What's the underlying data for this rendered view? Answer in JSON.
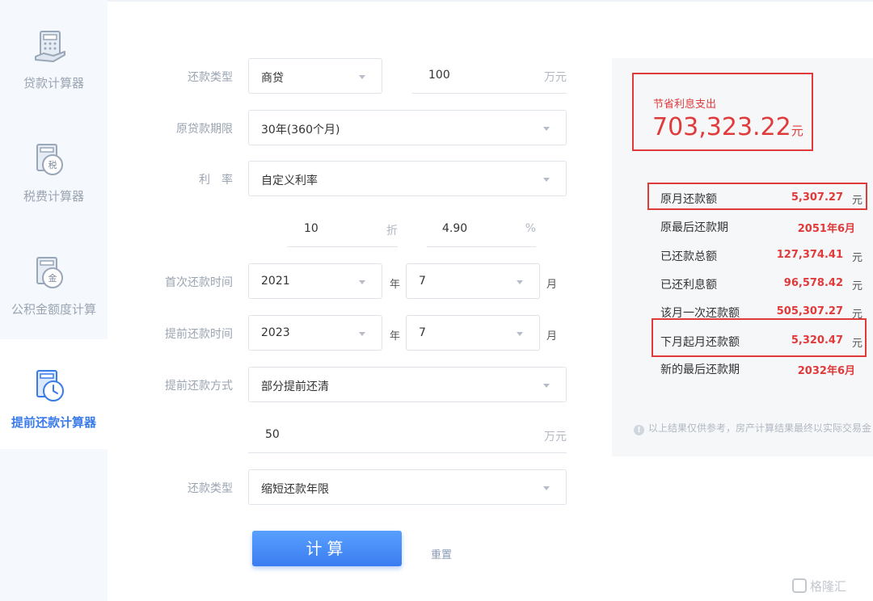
{
  "sidebar": {
    "items": [
      {
        "label": "贷款计算器",
        "icon": "loan-calculator-icon"
      },
      {
        "label": "税费计算器",
        "icon": "tax-calculator-icon"
      },
      {
        "label": "公积金额度计算",
        "icon": "fund-calculator-icon"
      },
      {
        "label": "提前还款计算器",
        "icon": "prepayment-calculator-icon",
        "active": true
      }
    ],
    "icon_glyphs": {
      "tax": "税",
      "fund": "金"
    }
  },
  "form": {
    "repay_type_label": "还款类型",
    "repay_type_value": "商贷",
    "amount_value": "100",
    "amount_unit": "万元",
    "term_label": "原贷款期限",
    "term_value": "30年(360个月)",
    "rate_label": "利　率",
    "rate_value": "自定义利率",
    "discount_value": "10",
    "discount_unit": "折",
    "rate_pct_value": "4.90",
    "rate_pct_unit": "%",
    "first_pay_label": "首次还款时间",
    "first_pay_year": "2021",
    "first_pay_month": "7",
    "prepay_time_label": "提前还款时间",
    "prepay_year": "2023",
    "prepay_month": "7",
    "year_unit": "年",
    "month_unit": "月",
    "prepay_method_label": "提前还款方式",
    "prepay_method_value": "部分提前还清",
    "prepay_amount_value": "50",
    "prepay_amount_unit": "万元",
    "after_type_label": "还款类型",
    "after_type_value": "缩短还款年限",
    "calc_button": "计算",
    "reset_link": "重置"
  },
  "result": {
    "saving_title": "节省利息支出",
    "saving_amount": "703,323.22",
    "saving_unit": "元",
    "rows": [
      {
        "label": "原月还款额",
        "value": "5,307.27",
        "unit": "元"
      },
      {
        "label": "原最后还款期",
        "value": "2051年6月",
        "unit": ""
      },
      {
        "label": "已还款总额",
        "value": "127,374.41",
        "unit": "元"
      },
      {
        "label": "已还利息额",
        "value": "96,578.42",
        "unit": "元"
      },
      {
        "label": "该月一次还款额",
        "value": "505,307.27",
        "unit": "元"
      },
      {
        "label": "下月起月还款额",
        "value": "5,320.47",
        "unit": "元"
      },
      {
        "label": "新的最后还款期",
        "value": "2032年6月",
        "unit": ""
      }
    ],
    "notice": "以上结果仅供参考，房产计算结果最终以实际交易金",
    "notice_icon": "!"
  },
  "watermark": "格隆汇",
  "colors": {
    "accent": "#3a7bea",
    "highlight": "#e03a3a"
  }
}
